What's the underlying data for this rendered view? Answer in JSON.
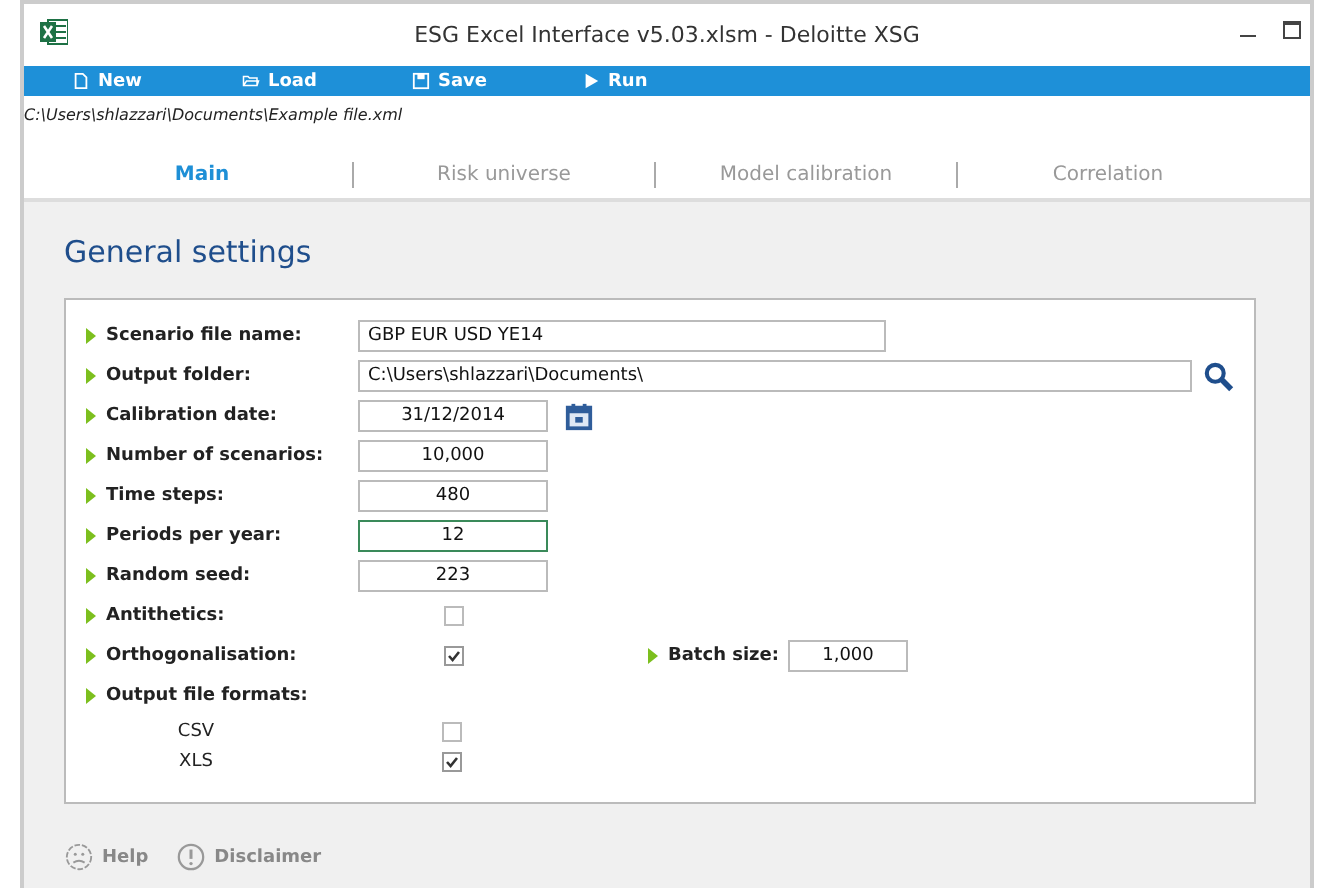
{
  "window": {
    "title": "ESG Excel Interface v5.03.xlsm  - Deloitte XSG"
  },
  "toolbar": [
    {
      "kind": "new",
      "label": "New"
    },
    {
      "kind": "load",
      "label": "Load"
    },
    {
      "kind": "save",
      "label": "Save"
    },
    {
      "kind": "run",
      "label": "Run"
    }
  ],
  "file_path": "C:\\Users\\shlazzari\\Documents\\Example file.xml",
  "tabs": [
    {
      "label": "Main",
      "selected": true
    },
    {
      "label": "Risk universe",
      "selected": false
    },
    {
      "label": "Model calibration",
      "selected": false
    },
    {
      "label": "Correlation",
      "selected": false
    }
  ],
  "section_title": "General settings",
  "fields": [
    {
      "kind": "name",
      "label": "Scenario file name:",
      "value": "GBP EUR USD YE14",
      "focused": false
    },
    {
      "kind": "folder",
      "label": "Output folder:",
      "value": "C:\\Users\\shlazzari\\Documents\\",
      "focused": false
    },
    {
      "kind": "date",
      "label": "Calibration date:",
      "value": "31/12/2014",
      "focused": false
    },
    {
      "kind": "number",
      "label": "Number of scenarios:",
      "value": "10,000",
      "focused": false
    },
    {
      "kind": "number",
      "label": "Time steps:",
      "value": "480",
      "focused": false
    },
    {
      "kind": "number",
      "label": "Periods per year:",
      "value": "12",
      "focused": true
    },
    {
      "kind": "number",
      "label": "Random seed:",
      "value": "223",
      "focused": false
    },
    {
      "kind": "checkbox",
      "label": "Antithetics:",
      "checked": false
    },
    {
      "kind": "checkbox",
      "label": "Orthogonalisation:",
      "checked": true,
      "extra": {
        "label": "Batch size:",
        "value": "1,000"
      }
    },
    {
      "kind": "group",
      "label": "Output file formats:",
      "options": [
        {
          "label": "CSV",
          "checked": false
        },
        {
          "label": "XLS",
          "checked": true
        }
      ]
    }
  ],
  "footer": [
    {
      "kind": "help",
      "label": "Help"
    },
    {
      "kind": "disclaimer",
      "label": "Disclaimer"
    }
  ]
}
